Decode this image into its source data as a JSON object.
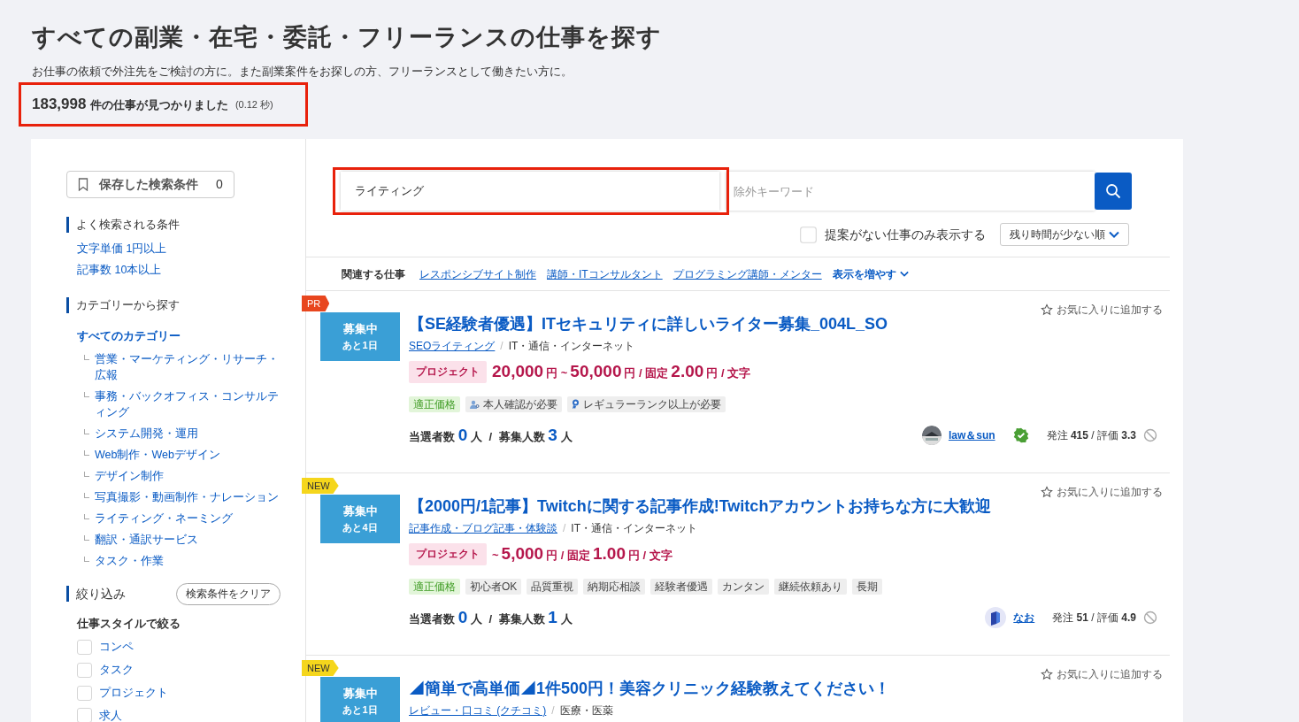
{
  "header": {
    "title": "すべての副業・在宅・委託・フリーランスの仕事を探す",
    "description": "お仕事の依頼で外注先をご検討の方に。また副業案件をお探しの方、フリーランスとして働きたい方に。",
    "result": {
      "count": "183,998",
      "label": "件の仕事が見つかりました",
      "time": "(0.12 秒)",
      "highlighted": true
    }
  },
  "sidebar": {
    "saved_button": {
      "label": "保存した検索条件",
      "count": "0"
    },
    "popular": {
      "heading": "よく検索される条件",
      "links": [
        "文字単価 1円以上",
        "記事数 10本以上"
      ]
    },
    "categories": {
      "heading": "カテゴリーから探す",
      "all": "すべてのカテゴリー",
      "items": [
        "営業・マーケティング・リサーチ・広報",
        "事務・バックオフィス・コンサルティング",
        "システム開発・運用",
        "Web制作・Webデザイン",
        "デザイン制作",
        "写真撮影・動画制作・ナレーション",
        "ライティング・ネーミング",
        "翻訳・通訳サービス",
        "タスク・作業"
      ]
    },
    "filter": {
      "heading": "絞り込み",
      "clear_button": "検索条件をクリア",
      "subheading": "仕事スタイルで絞る",
      "options": [
        {
          "label": "コンペ",
          "checked": false
        },
        {
          "label": "タスク",
          "checked": false
        },
        {
          "label": "プロジェクト",
          "checked": false
        },
        {
          "label": "求人",
          "checked": false
        }
      ]
    }
  },
  "search": {
    "keyword": {
      "value": "ライティング",
      "highlighted": true
    },
    "exclude": {
      "placeholder": "除外キーワード"
    },
    "no_proposal": {
      "label": "提案がない仕事のみ表示する",
      "checked": false
    },
    "sort": "残り時間が少ない順"
  },
  "related": {
    "label": "関連する仕事",
    "links": [
      "レスポンシブサイト制作",
      "講師・ITコンサルタント",
      "プログラミング講師・メンター"
    ],
    "more": "表示を増やす"
  },
  "jobs": [
    {
      "ribbon": {
        "kind": "pr",
        "text": "PR"
      },
      "favorite": "お気に入りに追加する",
      "status": "募集中",
      "remaining": "あと1日",
      "title": "【SE経験者優遇】ITセキュリティに詳しいライター募集_004L_SO",
      "category": "SEOライティング",
      "separator": "/",
      "industry": "IT・通信・インターネット",
      "type": "プロジェクト",
      "price": [
        {
          "kind": "num",
          "text": "20,000"
        },
        {
          "kind": "unit",
          "text": "円 ~"
        },
        {
          "kind": "num",
          "text": "50,000"
        },
        {
          "kind": "unit",
          "text": "円 / 固定"
        },
        {
          "kind": "num",
          "text": "2.00"
        },
        {
          "kind": "unit",
          "text": "円 / 文字"
        }
      ],
      "tags": [
        {
          "kind": "green",
          "text": "適正価格"
        },
        {
          "kind": "person",
          "text": "本人確認が必要"
        },
        {
          "kind": "badge",
          "text": "レギュラーランク以上が必要"
        }
      ],
      "stats": {
        "winners_label": "当選者数",
        "winners": "0",
        "winners_unit": "人",
        "separator": "/",
        "slots_label": "募集人数",
        "slots": "3",
        "slots_unit": "人"
      },
      "client": {
        "name": "law＆sun",
        "verified": true,
        "stats": "発注 **415** / 評価 **3.3**"
      }
    },
    {
      "ribbon": {
        "kind": "new",
        "text": "NEW"
      },
      "favorite": "お気に入りに追加する",
      "status": "募集中",
      "remaining": "あと4日",
      "title": "【2000円/1記事】Twitchに関する記事作成!Twitchアカウントお持ちな方に大歓迎",
      "category": "記事作成・ブログ記事・体験談",
      "separator": "/",
      "industry": "IT・通信・インターネット",
      "type": "プロジェクト",
      "price": [
        {
          "kind": "unit",
          "text": "~"
        },
        {
          "kind": "num",
          "text": "5,000"
        },
        {
          "kind": "unit",
          "text": "円 / 固定"
        },
        {
          "kind": "num",
          "text": "1.00"
        },
        {
          "kind": "unit",
          "text": "円 / 文字"
        }
      ],
      "tags": [
        {
          "kind": "green",
          "text": "適正価格"
        },
        {
          "kind": "plain",
          "text": "初心者OK"
        },
        {
          "kind": "plain",
          "text": "品質重視"
        },
        {
          "kind": "plain",
          "text": "納期応相談"
        },
        {
          "kind": "plain",
          "text": "経験者優遇"
        },
        {
          "kind": "plain",
          "text": "カンタン"
        },
        {
          "kind": "plain",
          "text": "継続依頼あり"
        },
        {
          "kind": "plain",
          "text": "長期"
        }
      ],
      "stats": {
        "winners_label": "当選者数",
        "winners": "0",
        "winners_unit": "人",
        "separator": "/",
        "slots_label": "募集人数",
        "slots": "1",
        "slots_unit": "人"
      },
      "client": {
        "kind": "logo",
        "name": "なお",
        "verified": false,
        "stats": "発注 **51** / 評価 **4.9**"
      }
    },
    {
      "ribbon": {
        "kind": "new",
        "text": "NEW"
      },
      "favorite": "お気に入りに追加する",
      "status": "募集中",
      "remaining": "あと1日",
      "title": "◢簡単で高単価◢1件500円！美容クリニック経験教えてください！",
      "category": "レビュー・口コミ (クチコミ)",
      "separator": "/",
      "industry": "医療・医薬"
    }
  ]
}
